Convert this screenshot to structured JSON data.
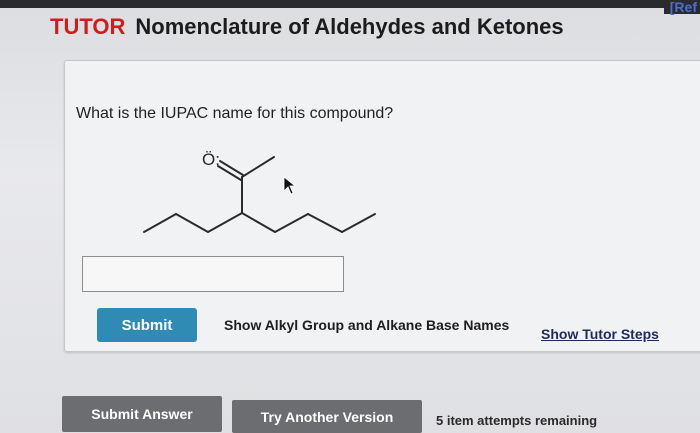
{
  "header": {
    "ref_link": "[Ref",
    "tutor_label": "TUTOR",
    "title": "Nomenclature of Aldehydes and Ketones"
  },
  "question": {
    "prompt": "What is the IUPAC name for this compound?",
    "structure": {
      "oxygen_label": "Ö:"
    }
  },
  "answer": {
    "value": "",
    "placeholder": ""
  },
  "actions": {
    "submit_label": "Submit",
    "alkyl_link": "Show Alkyl Group and Alkane Base Names",
    "tutor_steps_link": "Show Tutor Steps"
  },
  "footer": {
    "submit_answer_label": "Submit Answer",
    "try_another_label": "Try Another Version",
    "attempts_text": "5 item attempts remaining"
  },
  "colors": {
    "tutor_red": "#c8201e",
    "submit_blue": "#2f8ab4",
    "footer_gray": "#6c6d71"
  }
}
